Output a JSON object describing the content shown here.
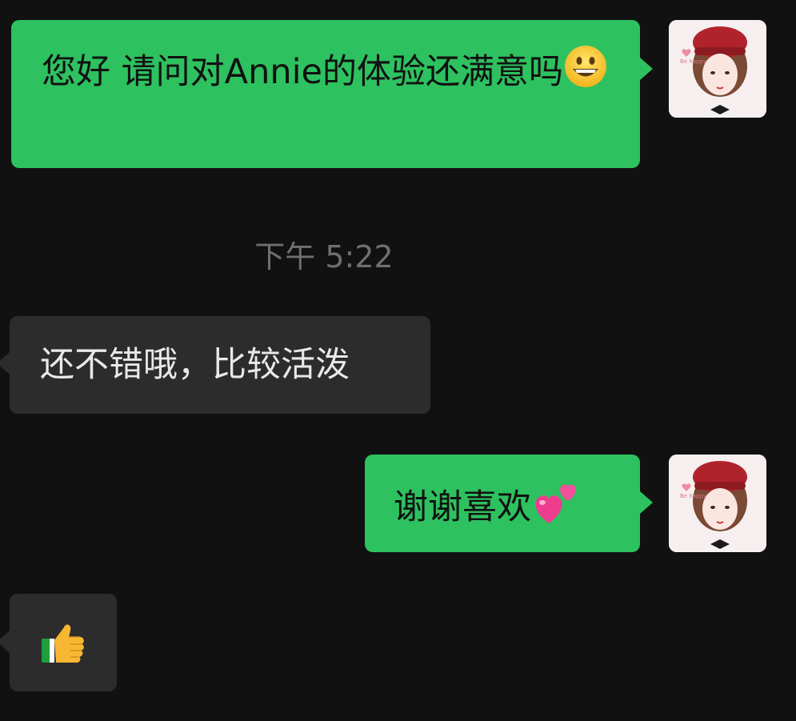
{
  "messages": [
    {
      "side": "out",
      "text": "您好 请问对Annie的体验还满意吗",
      "emoji": "grinning-face"
    },
    {
      "timestamp": "下午 5:22"
    },
    {
      "side": "in",
      "text": "还不错哦，比较活泼"
    },
    {
      "side": "out",
      "text": "谢谢喜欢",
      "emoji": "two-hearts"
    },
    {
      "side": "in",
      "text": "",
      "emoji": "thumbs-up"
    }
  ],
  "avatar": {
    "icon": "girl-red-beret-avatar",
    "caption": "Be happy"
  },
  "colors": {
    "background": "#111111",
    "outgoing": "#2dc15f",
    "incoming": "#2c2c2c",
    "timestamp": "#6f6f6f"
  }
}
